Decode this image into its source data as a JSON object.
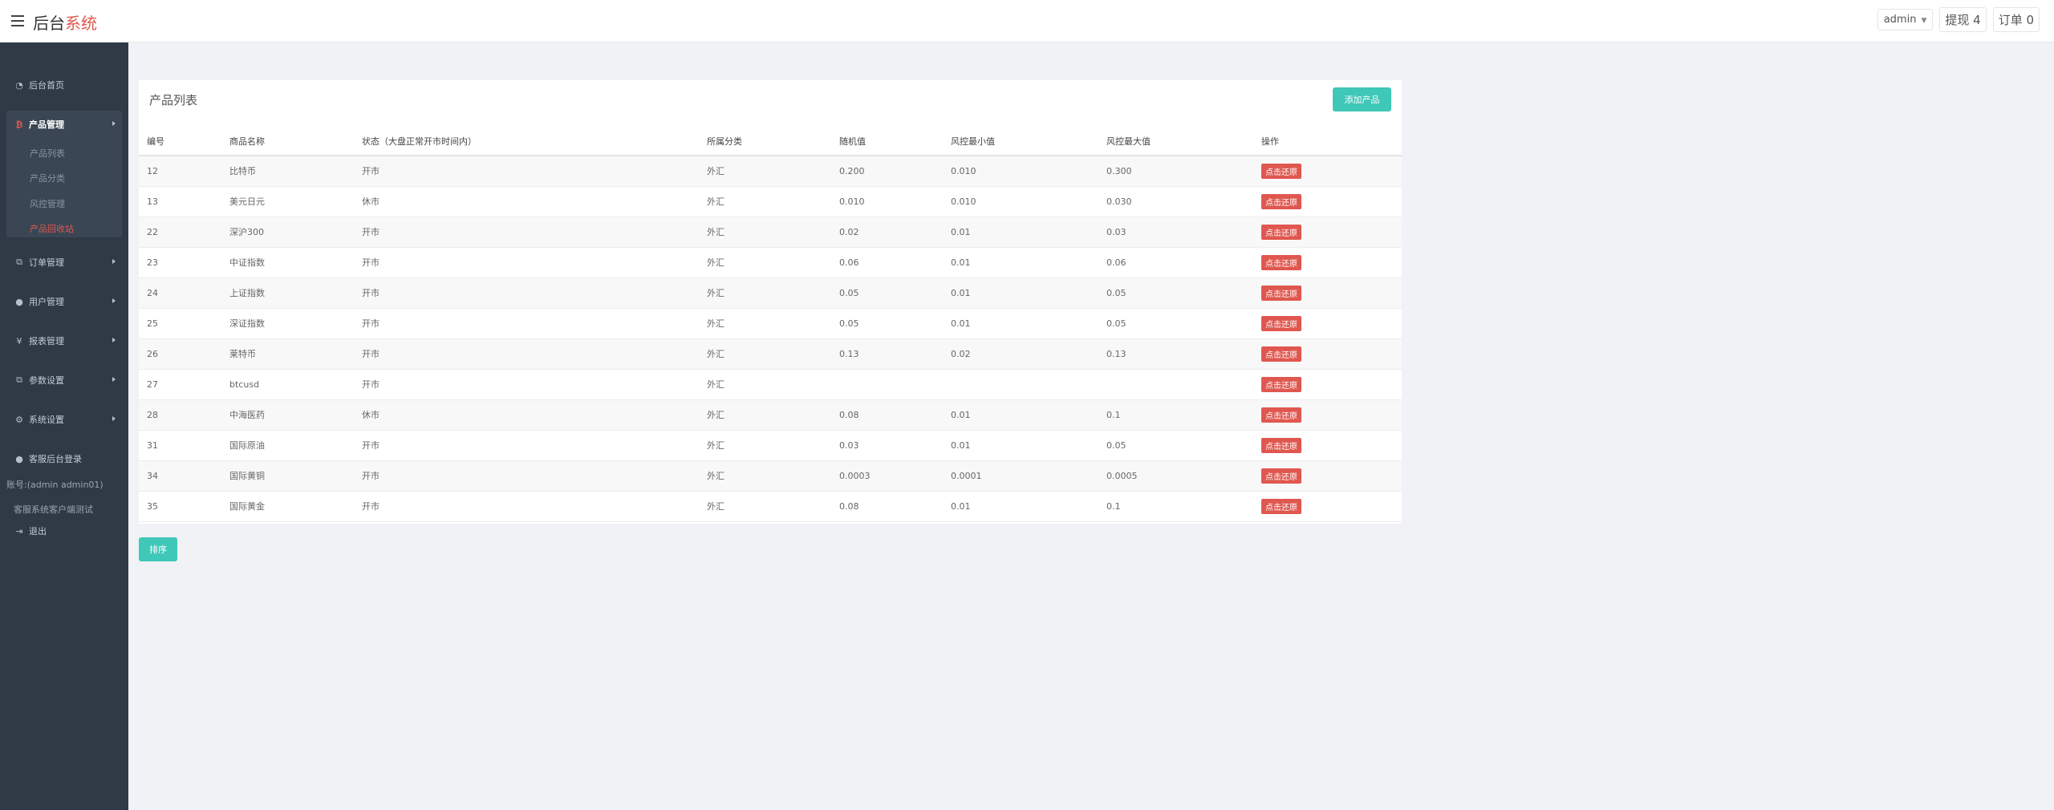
{
  "header": {
    "brand_main": "后台",
    "brand_accent": "系统",
    "admin_label": "admin",
    "withdraw_label": "提现 4",
    "orders_label": "订单 0"
  },
  "sidebar": {
    "dashboard": "后台首页",
    "product_mgmt": "产品管理",
    "product_sub": [
      "产品列表",
      "产品分类",
      "风控管理",
      "产品回收站"
    ],
    "order_mgmt": "订单管理",
    "user_mgmt": "用户管理",
    "report_mgmt": "报表管理",
    "param_settings": "参数设置",
    "system_settings": "系统设置",
    "cs_login": "客服后台登录",
    "account_text": "账号:(admin admin01)",
    "cs_test": "客服系统客户端测试",
    "logout": "退出"
  },
  "panel": {
    "title": "产品列表",
    "add_button": "添加产品",
    "sort_button": "排序"
  },
  "table": {
    "headers": [
      "编号",
      "商品名称",
      "状态（大盘正常开市时间内）",
      "所属分类",
      "随机值",
      "风控最小值",
      "风控最大值",
      "操作"
    ],
    "action_label": "点击还原",
    "rows": [
      [
        "12",
        "比特币",
        "开市",
        "外汇",
        "0.200",
        "0.010",
        "0.300"
      ],
      [
        "13",
        "美元日元",
        "休市",
        "外汇",
        "0.010",
        "0.010",
        "0.030"
      ],
      [
        "22",
        "深沪300",
        "开市",
        "外汇",
        "0.02",
        "0.01",
        "0.03"
      ],
      [
        "23",
        "中证指数",
        "开市",
        "外汇",
        "0.06",
        "0.01",
        "0.06"
      ],
      [
        "24",
        "上证指数",
        "开市",
        "外汇",
        "0.05",
        "0.01",
        "0.05"
      ],
      [
        "25",
        "深证指数",
        "开市",
        "外汇",
        "0.05",
        "0.01",
        "0.05"
      ],
      [
        "26",
        "莱特币",
        "开市",
        "外汇",
        "0.13",
        "0.02",
        "0.13"
      ],
      [
        "27",
        "btcusd",
        "开市",
        "外汇",
        "",
        "",
        ""
      ],
      [
        "28",
        "中海医药",
        "休市",
        "外汇",
        "0.08",
        "0.01",
        "0.1"
      ],
      [
        "31",
        "国际原油",
        "开市",
        "外汇",
        "0.03",
        "0.01",
        "0.05"
      ],
      [
        "34",
        "国际黄铜",
        "开市",
        "外汇",
        "0.0003",
        "0.0001",
        "0.0005"
      ],
      [
        "35",
        "国际黄金",
        "开市",
        "外汇",
        "0.08",
        "0.01",
        "0.1"
      ]
    ]
  }
}
